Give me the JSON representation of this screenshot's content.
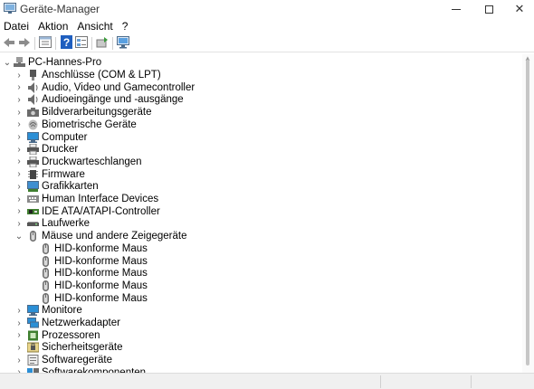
{
  "window": {
    "title": "Geräte-Manager",
    "icons": {
      "app": "device-manager-icon",
      "minimize": "minimize-icon",
      "maximize": "maximize-icon",
      "close": "close-icon"
    }
  },
  "menu": {
    "items": [
      {
        "label": "Datei"
      },
      {
        "label": "Aktion"
      },
      {
        "label": "Ansicht"
      },
      {
        "label": "?"
      }
    ]
  },
  "toolbar": {
    "buttons": [
      {
        "icon": "back-arrow-icon"
      },
      {
        "icon": "forward-arrow-icon"
      },
      {
        "icon": "properties-icon"
      },
      {
        "icon": "help-icon"
      },
      {
        "icon": "details-icon"
      },
      {
        "icon": "update-driver-icon"
      },
      {
        "icon": "scan-hardware-icon"
      }
    ]
  },
  "tree": {
    "root": {
      "label": "PC-Hannes-Pro",
      "expanded": true,
      "icon": "computer-root-icon"
    },
    "items": [
      {
        "label": "Anschlüsse (COM & LPT)",
        "icon": "port-icon",
        "expanded": false
      },
      {
        "label": "Audio, Video und Gamecontroller",
        "icon": "speaker-icon",
        "expanded": false
      },
      {
        "label": "Audioeingänge und -ausgänge",
        "icon": "speaker-icon",
        "expanded": false
      },
      {
        "label": "Bildverarbeitungsgeräte",
        "icon": "camera-icon",
        "expanded": false
      },
      {
        "label": "Biometrische Geräte",
        "icon": "fingerprint-icon",
        "expanded": false
      },
      {
        "label": "Computer",
        "icon": "monitor-icon",
        "expanded": false
      },
      {
        "label": "Drucker",
        "icon": "printer-icon",
        "expanded": false
      },
      {
        "label": "Druckwarteschlangen",
        "icon": "printer-icon",
        "expanded": false
      },
      {
        "label": "Firmware",
        "icon": "chip-icon",
        "expanded": false
      },
      {
        "label": "Grafikkarten",
        "icon": "display-adapter-icon",
        "expanded": false
      },
      {
        "label": "Human Interface Devices",
        "icon": "hid-icon",
        "expanded": false
      },
      {
        "label": "IDE ATA/ATAPI-Controller",
        "icon": "ide-controller-icon",
        "expanded": false
      },
      {
        "label": "Laufwerke",
        "icon": "disk-drive-icon",
        "expanded": false
      },
      {
        "label": "Mäuse und andere Zeigegeräte",
        "icon": "mouse-icon",
        "expanded": true,
        "children": [
          {
            "label": "HID-konforme Maus",
            "icon": "mouse-icon"
          },
          {
            "label": "HID-konforme Maus",
            "icon": "mouse-icon"
          },
          {
            "label": "HID-konforme Maus",
            "icon": "mouse-icon"
          },
          {
            "label": "HID-konforme Maus",
            "icon": "mouse-icon"
          },
          {
            "label": "HID-konforme Maus",
            "icon": "mouse-icon"
          }
        ]
      },
      {
        "label": "Monitore",
        "icon": "monitor-icon",
        "expanded": false
      },
      {
        "label": "Netzwerkadapter",
        "icon": "network-adapter-icon",
        "expanded": false
      },
      {
        "label": "Prozessoren",
        "icon": "processor-icon",
        "expanded": false
      },
      {
        "label": "Sicherheitsgeräte",
        "icon": "security-device-icon",
        "expanded": false
      },
      {
        "label": "Softwaregeräte",
        "icon": "software-device-icon",
        "expanded": false
      },
      {
        "label": "Softwarekomponenten",
        "icon": "software-component-icon",
        "expanded": false
      }
    ]
  },
  "colors": {
    "expander": "#555555",
    "monitor_blue": "#2b8fd6",
    "mouse_gray": "#6b6b6b",
    "help_blue": "#1f5fbf",
    "processor_green": "#3f7f2f"
  }
}
